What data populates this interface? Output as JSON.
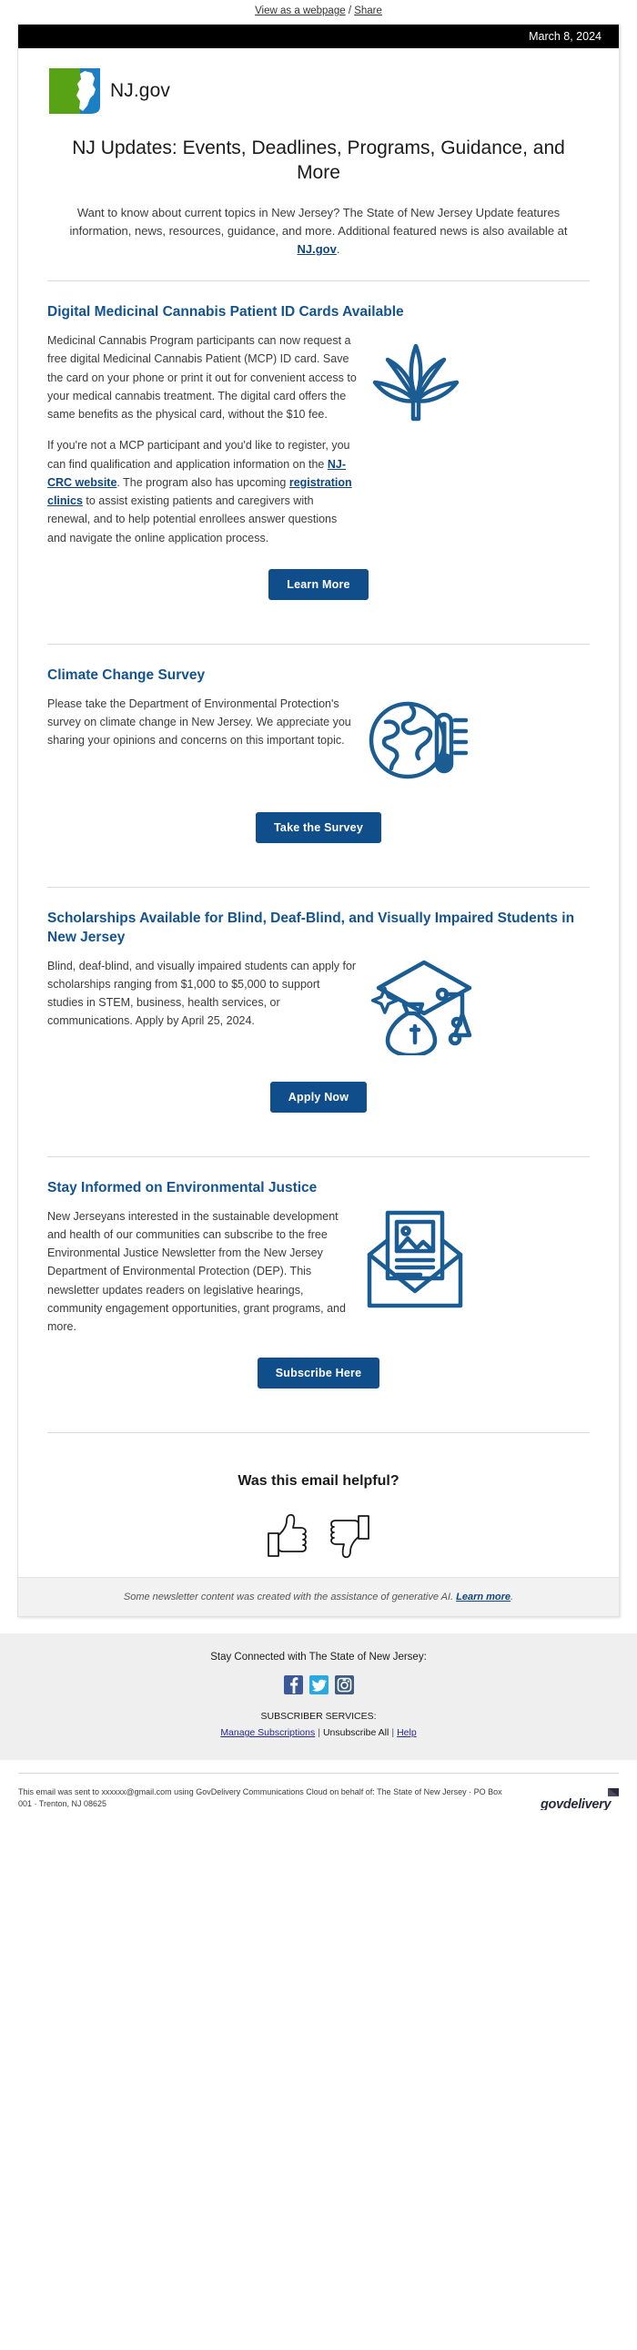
{
  "preheader": {
    "view_as_webpage": "View as a webpage",
    "separator": " / ",
    "share": "Share"
  },
  "header": {
    "date": "March 8, 2024",
    "logo_text": "NJ.gov",
    "logo_icon": "nj-state-logo"
  },
  "intro": {
    "headline": "NJ Updates: Events, Deadlines, Programs, Guidance, and More",
    "paragraph_before_link": "Want to know about current topics in New Jersey? The State of New Jersey Update features information, news, resources, guidance, and more. Additional featured news is also available at ",
    "link_label": "NJ.gov",
    "paragraph_after_link": "."
  },
  "articles": [
    {
      "id": "cannabis",
      "title": "Digital Medicinal Cannabis Patient ID Cards Available",
      "icon": "cannabis-leaf-icon",
      "paragraphs": [
        {
          "parts": [
            {
              "text": "Medicinal Cannabis Program participants can now request a free digital Medicinal Cannabis Patient (MCP) ID card. Save the card on your phone or print it out for convenient access to your medical cannabis treatment. The digital card offers the same benefits as the physical card, without the $10 fee.",
              "link": false
            }
          ]
        },
        {
          "parts": [
            {
              "text": "If you're not a MCP participant and you'd like to register, you can find qualification and application information on the ",
              "link": false
            },
            {
              "text": "NJ-CRC website",
              "link": true
            },
            {
              "text": ". The program also has upcoming ",
              "link": false
            },
            {
              "text": "registration clinics",
              "link": true
            },
            {
              "text": " to assist existing patients and caregivers with renewal, and to help potential enrollees answer questions and navigate the online application process.",
              "link": false
            }
          ]
        }
      ],
      "cta_label": "Learn More"
    },
    {
      "id": "climate",
      "title": "Climate Change Survey",
      "icon": "globe-thermometer-icon",
      "paragraphs": [
        {
          "parts": [
            {
              "text": "Please take the Department of Environmental Protection's survey on climate change in New Jersey. We appreciate you sharing your opinions and concerns on this important topic.",
              "link": false
            }
          ]
        }
      ],
      "cta_label": "Take the Survey"
    },
    {
      "id": "scholarships",
      "title": "Scholarships Available for Blind, Deaf-Blind, and Visually Impaired Students in New Jersey",
      "icon": "graduation-cap-money-bag-icon",
      "paragraphs": [
        {
          "parts": [
            {
              "text": "Blind, deaf-blind, and visually impaired students can apply for scholarships ranging from $1,000 to $5,000 to support studies in STEM, business, health services, or communications. Apply by April 25, 2024.",
              "link": false
            }
          ]
        }
      ],
      "cta_label": "Apply Now"
    },
    {
      "id": "environmental-justice",
      "title": "Stay Informed on Environmental Justice",
      "icon": "open-envelope-newsletter-icon",
      "paragraphs": [
        {
          "parts": [
            {
              "text": "New Jerseyans interested in the sustainable development and health of our communities can subscribe to the free Environmental Justice Newsletter from the New Jersey Department of Environmental Protection (DEP). This newsletter updates readers on legislative hearings, community engagement opportunities, grant programs, and more.",
              "link": false
            }
          ]
        }
      ],
      "cta_label": "Subscribe Here"
    }
  ],
  "feedback": {
    "question": "Was this email helpful?",
    "thumbs_up_icon": "thumbs-up-icon",
    "thumbs_down_icon": "thumbs-down-icon"
  },
  "ai_note": {
    "text": "Some newsletter content was created with the assistance of generative AI. ",
    "link_label": "Learn more",
    "trailing": "."
  },
  "footer": {
    "stay_connected": "Stay Connected with The State of New Jersey:",
    "social": [
      {
        "name": "facebook-icon",
        "label": "f",
        "color": "#3b5998"
      },
      {
        "name": "twitter-icon",
        "label": "t",
        "color": "#29a9e1"
      },
      {
        "name": "instagram-icon",
        "label": "i",
        "color": "#3f5d7e"
      }
    ],
    "subscriber_services_label": "SUBSCRIBER SERVICES:",
    "links": [
      {
        "label": "Manage Subscriptions",
        "is_link": true
      },
      {
        "label": "Unsubscribe All",
        "is_link": false
      },
      {
        "label": "Help",
        "is_link": true
      }
    ],
    "separator": "|"
  },
  "legal": {
    "text": "This email was sent to xxxxxx@gmail.com using GovDelivery Communications Cloud on behalf of: The State of New Jersey · PO Box 001 · Trenton, NJ 08625",
    "brand": "govdelivery",
    "brand_icon": "govdelivery-envelope-icon"
  },
  "colors": {
    "accent_blue": "#0f4e8a",
    "heading_blue": "#13538f",
    "link_blue": "#10467f",
    "logo_green": "#57a315",
    "logo_blue": "#1c7fc3",
    "bar_black": "#000000"
  }
}
